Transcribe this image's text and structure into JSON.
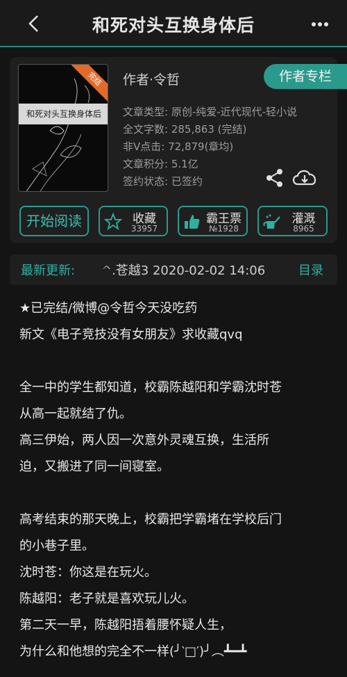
{
  "header": {
    "title": "和死对头互换身体后"
  },
  "book": {
    "cover_title": "和死对头互换身体后",
    "cover_badge": "完结",
    "author": "作者·令哲",
    "author_column_label": "作者专栏",
    "meta": [
      "文章类型: 原创-纯爱-近代现代-轻小说",
      "全文字数: 285,863 (完结)",
      "非Ⅴ点击: 72,879(章均)",
      "文章积分: 5.1亿",
      "签约状态:  已签约"
    ]
  },
  "actions": {
    "read_label": "开始阅读",
    "collect": {
      "label": "收藏",
      "count": "33957"
    },
    "bawang": {
      "label": "霸王票",
      "count": "№1928"
    },
    "irrigate": {
      "label": "灌溉",
      "count": "8965"
    }
  },
  "latest": {
    "label": "最新更新:",
    "text": "^.苍越3  2020-02-02 14:06",
    "catalog_label": "目录"
  },
  "description": {
    "lines": [
      "★已完结/微博@令哲今天没吃药",
      "新文《电子竞技没有女朋友》求收藏qvq",
      "",
      "全一中的学生都知道，校霸陈越阳和学霸沈时苍",
      "从高一起就结了仇。",
      "高三伊始，两人因一次意外灵魂互换，生活所",
      "迫，又搬进了同一间寝室。",
      "",
      "高考结束的那天晚上，校霸把学霸堵在学校后门",
      "的小巷子里。",
      "沈时苍：你这是在玩火。",
      "陈越阳：老子就是喜欢玩儿火。",
      "第二天一早，陈越阳捂着腰怀疑人生，",
      "为什么和他想的完全不一样(╯‵□′)╯︵┻━┻"
    ]
  },
  "colors": {
    "accent": "#2a9a8c",
    "background": "#141414",
    "card": "#1f1f1f",
    "badge": "#e46a2a"
  },
  "icons": {
    "back": "back-arrow-icon",
    "more": "more-dots-icon",
    "share": "share-icon",
    "download": "cloud-download-icon",
    "collect": "star-icon",
    "bawang": "thumbs-up-icon",
    "irrigate": "watering-can-icon"
  }
}
